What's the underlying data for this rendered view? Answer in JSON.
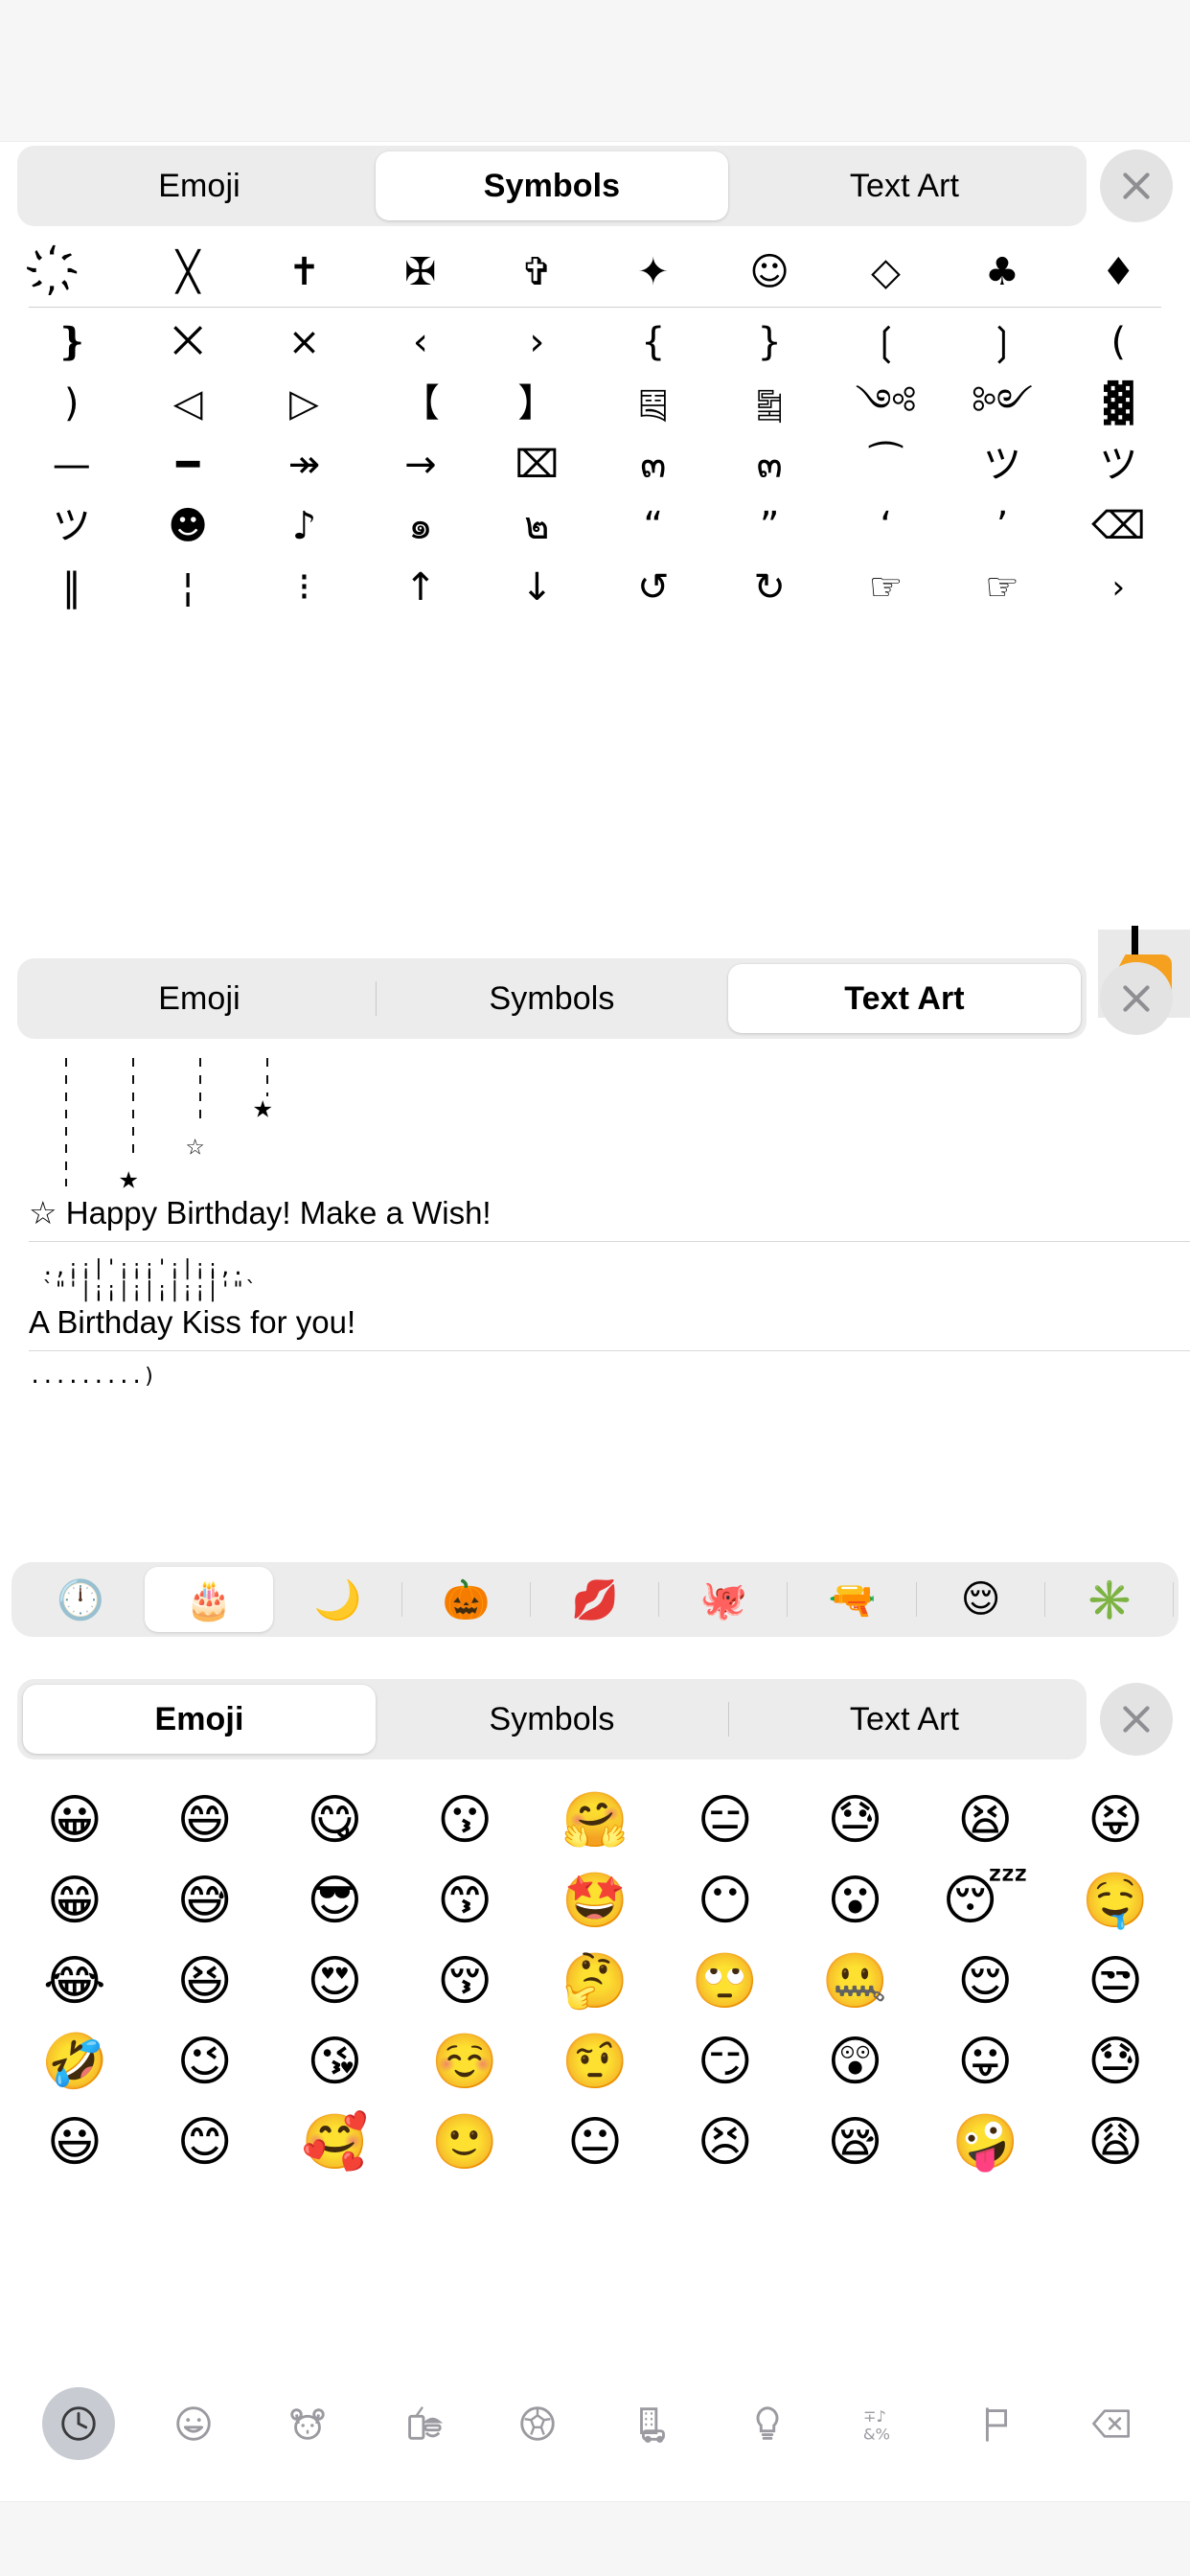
{
  "app": {
    "title": "Emoji & Symbols Keyboard",
    "accent_orange": "#F5A01E",
    "bg": "#ffffff",
    "segment_track": "#ececec",
    "segment_active": "#ffffff",
    "close_circle": "#e3e3e3"
  },
  "tabs": {
    "emoji": "Emoji",
    "symbols": "Symbols",
    "text_art": "Text Art",
    "close_icon": "close-x-icon"
  },
  "panel_symbols": {
    "selected_tab": "Symbols",
    "rows": [
      [
        "҉",
        "╳",
        "✝",
        "✠",
        "✞",
        "✦",
        "☺",
        "◇",
        "♣",
        "♦"
      ],
      [
        "❵",
        "⨉",
        "⨯",
        "‹",
        "›",
        "{",
        "}",
        "❲",
        "❳",
        "("
      ],
      [
        ")",
        "◁",
        "▷",
        "【",
        "】",
        "༕",
        "༖",
        "༺",
        "༻",
        "▓"
      ],
      [
        "—",
        "━",
        "↠",
        "→",
        "⌧",
        "๓",
        "๓",
        "͡",
        "ツ",
        "ツ"
      ],
      [
        "ツ",
        "☻",
        "♪",
        "๑",
        "๒",
        "“",
        "”",
        "‘",
        "’",
        "⌫"
      ],
      [
        "‖",
        "¦",
        "⁝",
        "↑",
        "↓",
        "↺",
        "↻",
        "☞",
        "☞",
        "›"
      ]
    ],
    "delete_key": {
      "icon": "backspace-delete-icon",
      "glyph": "✕"
    },
    "page_next_icon": "chevron-right-icon"
  },
  "panel_textart": {
    "selected_tab": "Text Art",
    "items": [
      {
        "art_lines": [
          "  ¦      ¦      ¦      ¦",
          "  ¦      ¦      ¦      ★",
          "  ¦      ¦      ☆",
          "  ¦      ★"
        ],
        "label": "☆ Happy Birthday! Make a Wish!"
      },
      {
        "art_lines": [
          " .,¡¡|'¡¡¡'¡|¡¡,.",
          " `\"'|¡¡|¡|¡|¡¡|'\"`"
        ],
        "label": "A Birthday Kiss for you!"
      },
      {
        "art_lines": [
          ".........)"
        ],
        "label": ""
      }
    ]
  },
  "emoji_category_bar": {
    "categories": [
      {
        "name": "recent-clock",
        "glyph": "🕛",
        "selected": false
      },
      {
        "name": "birthday-cake",
        "glyph": "🎂",
        "selected": true
      },
      {
        "name": "crescent-moon",
        "glyph": "🌙",
        "selected": false
      },
      {
        "name": "jack-o-lantern",
        "glyph": "🎃",
        "selected": false
      },
      {
        "name": "kiss-mark",
        "glyph": "💋",
        "selected": false
      },
      {
        "name": "octopus",
        "glyph": "🐙",
        "selected": false
      },
      {
        "name": "water-pistol",
        "glyph": "🔫",
        "selected": false
      },
      {
        "name": "relieved-face",
        "glyph": "😌",
        "selected": false
      },
      {
        "name": "sparkle-asterisks",
        "glyph": "✳️",
        "selected": false
      }
    ]
  },
  "panel_emoji": {
    "selected_tab": "Emoji",
    "rows": [
      [
        "😀",
        "😄",
        "😋",
        "😗",
        "🤗",
        "😑",
        "😓",
        "😫",
        "😝"
      ],
      [
        "😁",
        "😅",
        "😎",
        "😙",
        "🤩",
        "😶",
        "😮",
        "😴",
        "🤤"
      ],
      [
        "😂",
        "😆",
        "😍",
        "😚",
        "🤔",
        "🙄",
        "🤐",
        "😌",
        "😒"
      ],
      [
        "🤣",
        "😉",
        "😘",
        "☺️",
        "🤨",
        "😏",
        "😲",
        "😛",
        "😓"
      ],
      [
        "😃",
        "😊",
        "🥰",
        "🙂",
        "😐",
        "😣",
        "😪",
        "🤪",
        "😩"
      ]
    ]
  },
  "keyboard_toolbar": {
    "buttons": [
      {
        "name": "recent-clock-icon",
        "selected": true
      },
      {
        "name": "smileys-face-icon",
        "selected": false
      },
      {
        "name": "animals-nature-icon",
        "selected": false
      },
      {
        "name": "food-drink-icon",
        "selected": false
      },
      {
        "name": "activity-ball-icon",
        "selected": false
      },
      {
        "name": "travel-places-icon",
        "selected": false
      },
      {
        "name": "objects-bulb-icon",
        "selected": false
      },
      {
        "name": "symbols-icon",
        "selected": false
      },
      {
        "name": "flags-icon",
        "selected": false
      },
      {
        "name": "backspace-icon",
        "selected": false
      }
    ]
  }
}
